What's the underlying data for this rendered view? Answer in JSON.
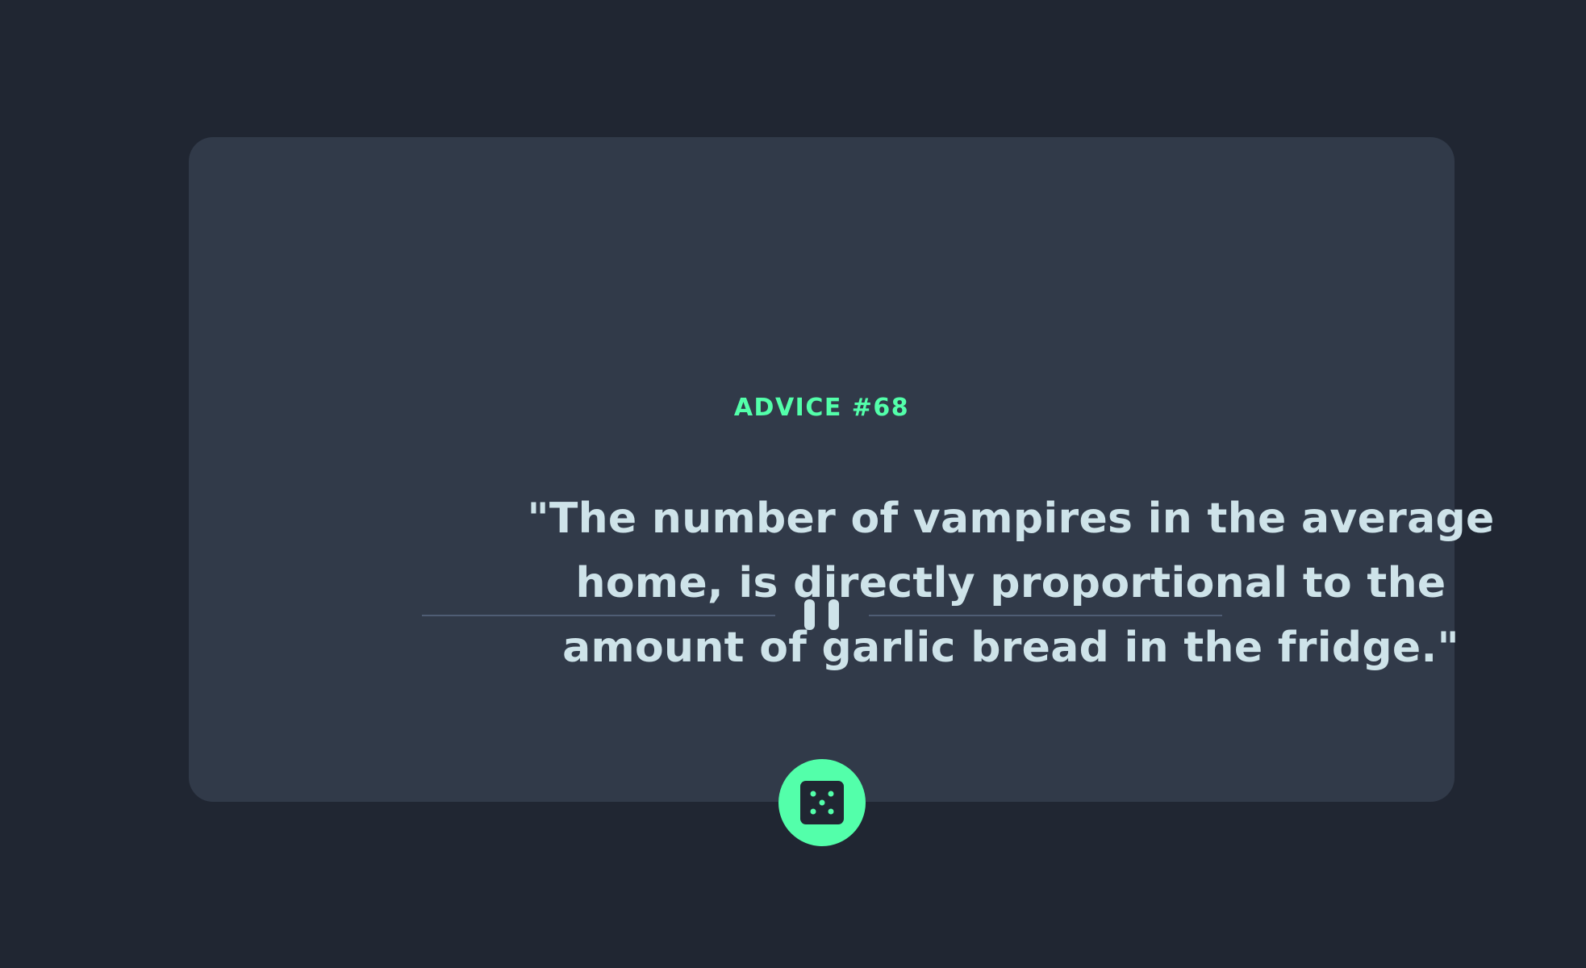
{
  "advice": {
    "id_label": "ADVICE #68",
    "text": "\"The number of vampires in the average home, is directly proportional to the amount of garlic bread in the fridge.\""
  },
  "divider": {
    "icon": "pause-icon"
  },
  "action": {
    "icon": "dice-icon"
  },
  "colors": {
    "background": "#202632",
    "card": "#313a49",
    "accent": "#53ffaa",
    "text": "#cee3e9",
    "divider": "#4f5d74"
  }
}
